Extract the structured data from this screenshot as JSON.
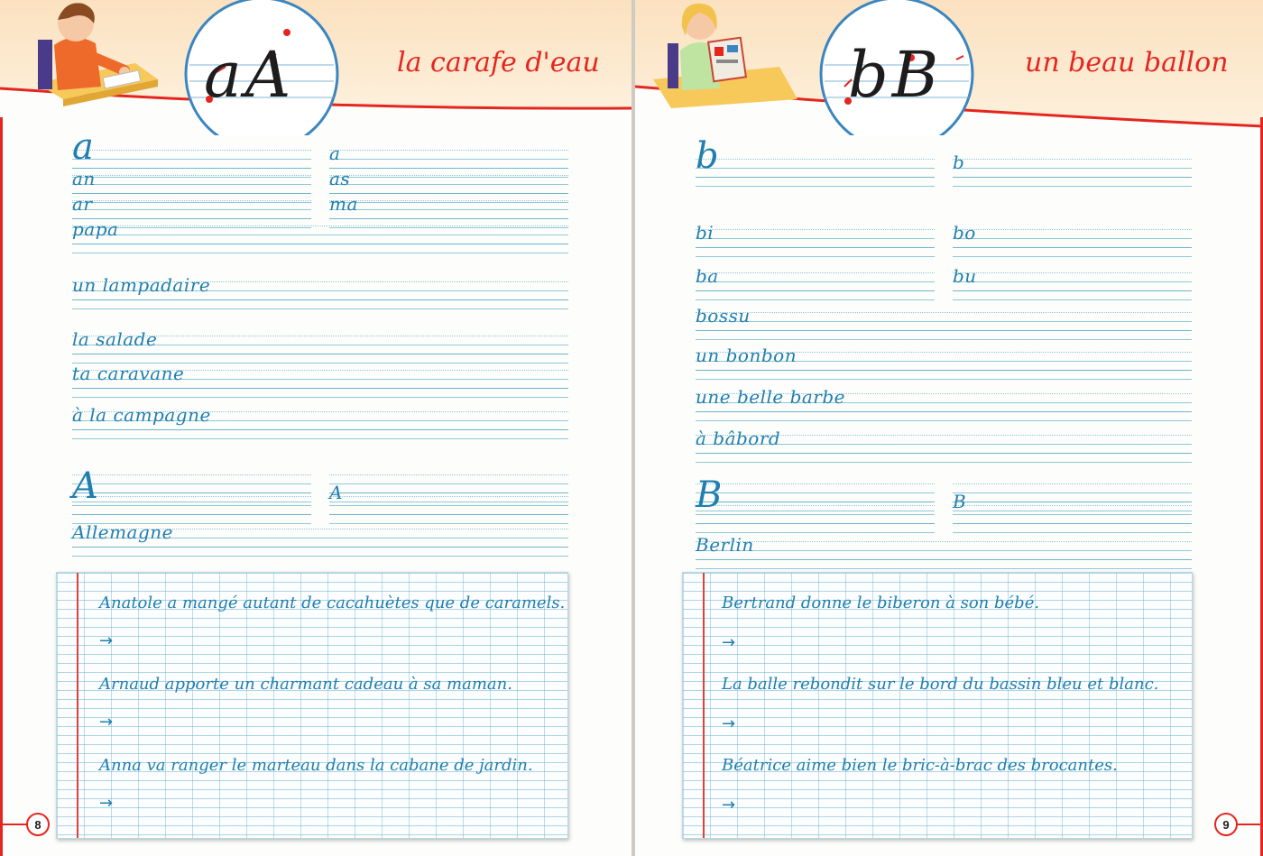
{
  "left_page": {
    "motto": "la carafe d'eau",
    "circle_letters": "aA",
    "page_number": "8",
    "models_small": [
      {
        "text": "a",
        "size": "big",
        "col": 0,
        "row": 0
      },
      {
        "text": "a",
        "size": "med",
        "col": 1,
        "row": 0
      },
      {
        "text": "an",
        "size": "med",
        "col": 0,
        "row": 1
      },
      {
        "text": "as",
        "size": "med",
        "col": 1,
        "row": 1
      },
      {
        "text": "ar",
        "size": "med",
        "col": 0,
        "row": 2
      },
      {
        "text": "ma",
        "size": "med",
        "col": 1,
        "row": 2
      }
    ],
    "models_lines": [
      "papa",
      "un lampadaire",
      "la salade",
      "ta caravane",
      "à la campagne"
    ],
    "capital_models": [
      "A",
      "A"
    ],
    "capital_word": "Allemagne",
    "sentences": [
      "Anatole a mangé autant de cacahuètes que de caramels.",
      "Arnaud apporte un charmant cadeau à sa maman.",
      "Anna va ranger le marteau dans la cabane de jardin."
    ],
    "arrow": "→"
  },
  "right_page": {
    "motto": "un beau ballon",
    "circle_letters": "bB",
    "page_number": "9",
    "models_small": [
      {
        "text": "b",
        "size": "big",
        "col": 0,
        "row": 0
      },
      {
        "text": "b",
        "size": "med",
        "col": 1,
        "row": 0
      },
      {
        "text": "bi",
        "size": "med",
        "col": 0,
        "row": 1
      },
      {
        "text": "bo",
        "size": "med",
        "col": 1,
        "row": 1
      },
      {
        "text": "ba",
        "size": "med",
        "col": 0,
        "row": 2
      },
      {
        "text": "bu",
        "size": "med",
        "col": 1,
        "row": 2
      }
    ],
    "models_lines": [
      "bossu",
      "un bonbon",
      "une belle barbe",
      "à bâbord"
    ],
    "capital_models": [
      "B",
      "B"
    ],
    "capital_word": "Berlin",
    "sentences": [
      "Bertrand donne le biberon à son bébé.",
      "La balle rebondit sur le bord du bassin bleu et blanc.",
      "Béatrice aime bien le bric-à-brac des brocantes."
    ],
    "arrow": "→"
  },
  "colors": {
    "accent_red": "#e4261f",
    "ink_blue": "#1f7fb0",
    "rule_blue": "#8fc8d8",
    "header_peach": "#fbe3c4"
  }
}
